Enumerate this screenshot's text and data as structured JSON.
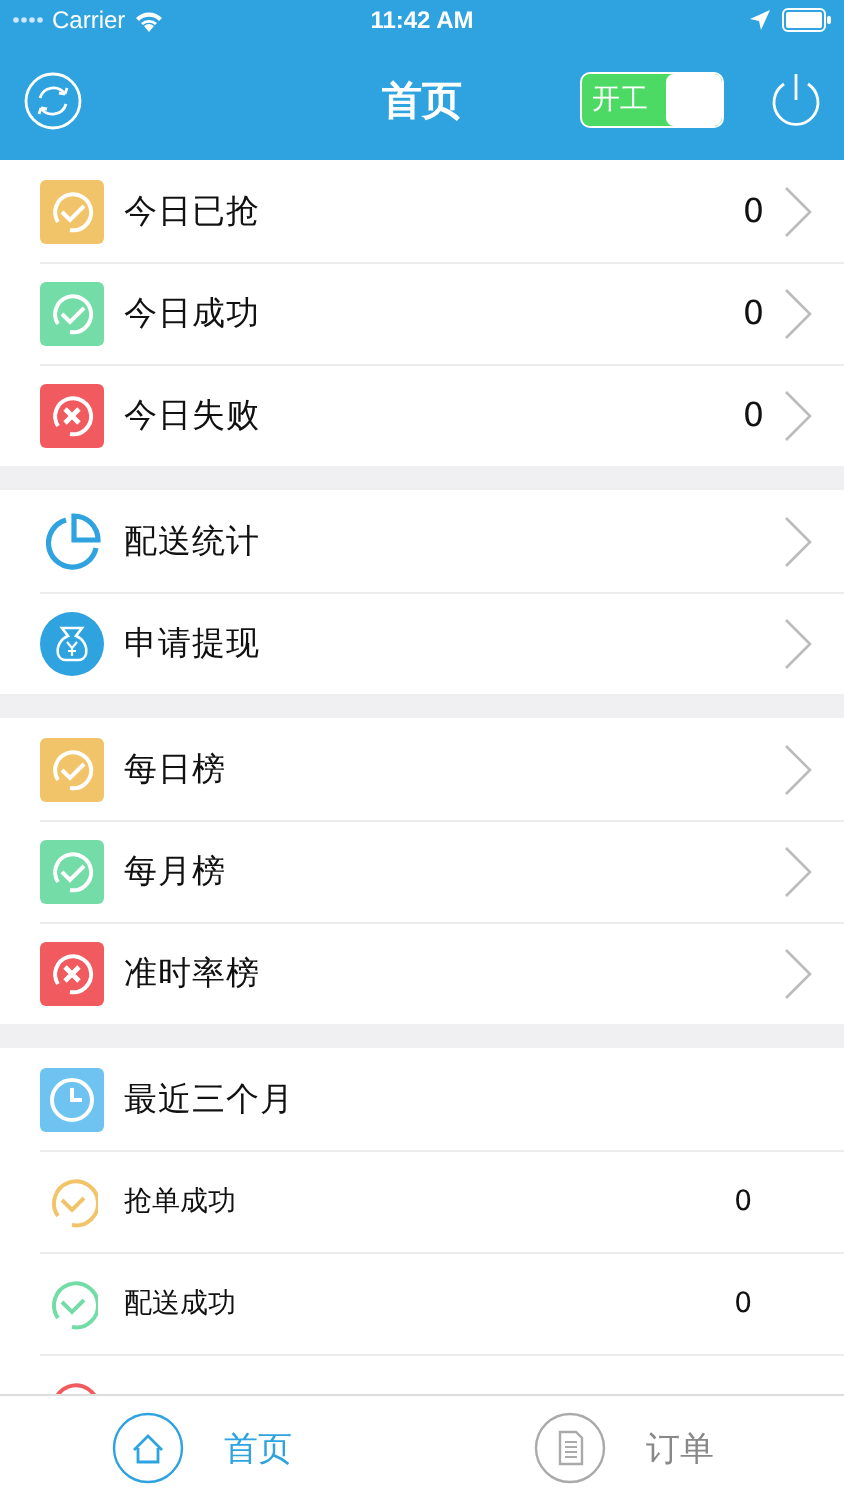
{
  "status_bar": {
    "carrier": "Carrier",
    "time": "11:42 AM"
  },
  "nav": {
    "title": "首页",
    "toggle": {
      "label": "开工",
      "on": true
    }
  },
  "sections": [
    {
      "rows": [
        {
          "kind": "square-check",
          "color": "#f2c46a",
          "label": "今日已抢",
          "value": "0",
          "chevron": true
        },
        {
          "kind": "square-check",
          "color": "#74dca6",
          "label": "今日成功",
          "value": "0",
          "chevron": true
        },
        {
          "kind": "square-cross",
          "color": "#f15a5e",
          "label": "今日失败",
          "value": "0",
          "chevron": true
        }
      ]
    },
    {
      "rows": [
        {
          "kind": "pie",
          "color": "#2ea3e0",
          "label": "配送统计",
          "chevron": true
        },
        {
          "kind": "moneybag",
          "color": "#2ea3e0",
          "label": "申请提现",
          "chevron": true
        }
      ]
    },
    {
      "rows": [
        {
          "kind": "square-check",
          "color": "#f2c46a",
          "label": "每日榜",
          "chevron": true
        },
        {
          "kind": "square-check",
          "color": "#74dca6",
          "label": "每月榜",
          "chevron": true
        },
        {
          "kind": "square-cross",
          "color": "#f15a5e",
          "label": "准时率榜",
          "chevron": true
        }
      ]
    },
    {
      "rows": [
        {
          "kind": "clock",
          "color": "#6ec3f0",
          "label": "最近三个月",
          "chevron": false
        },
        {
          "kind": "ring-check",
          "color": "#f2c46a",
          "label": "抢单成功",
          "value": "0",
          "chevron": false
        },
        {
          "kind": "ring-check",
          "color": "#74dca6",
          "label": "配送成功",
          "value": "0",
          "chevron": false
        },
        {
          "kind": "ring-cross",
          "color": "#f15a5e",
          "chevron": false
        }
      ]
    }
  ],
  "tabs": [
    {
      "label": "首页",
      "kind": "home",
      "selected": true
    },
    {
      "label": "订单",
      "kind": "document",
      "selected": false
    }
  ]
}
